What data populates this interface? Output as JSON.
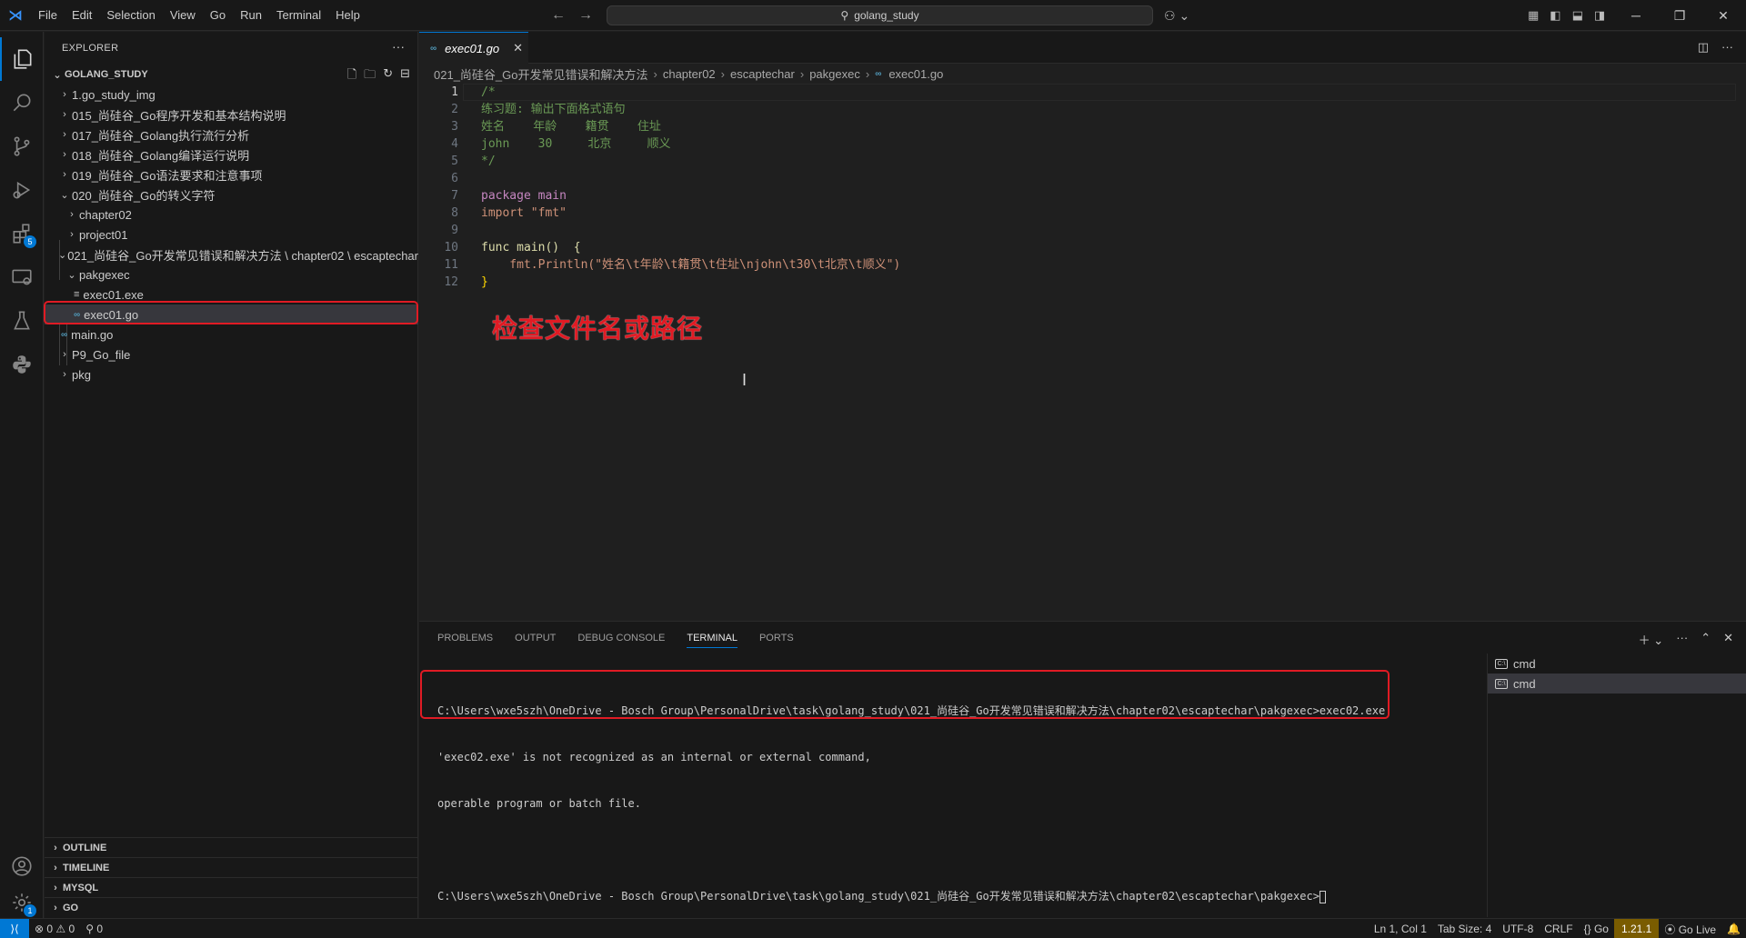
{
  "titlebar": {
    "menu": [
      "File",
      "Edit",
      "Selection",
      "View",
      "Go",
      "Run",
      "Terminal",
      "Help"
    ],
    "search_text": "golang_study"
  },
  "explorer": {
    "title": "EXPLORER",
    "project": "GOLANG_STUDY",
    "tree": [
      {
        "label": "1.go_study_img",
        "type": "folder",
        "expanded": false,
        "depth": 0
      },
      {
        "label": "015_尚硅谷_Go程序开发和基本结构说明",
        "type": "folder",
        "expanded": false,
        "depth": 0
      },
      {
        "label": "017_尚硅谷_Golang执行流行分析",
        "type": "folder",
        "expanded": false,
        "depth": 0
      },
      {
        "label": "018_尚硅谷_Golang编译运行说明",
        "type": "folder",
        "expanded": false,
        "depth": 0
      },
      {
        "label": "019_尚硅谷_Go语法要求和注意事项",
        "type": "folder",
        "expanded": false,
        "depth": 0
      },
      {
        "label": "020_尚硅谷_Go的转义字符",
        "type": "folder",
        "expanded": true,
        "depth": 0
      },
      {
        "label": "chapter02",
        "type": "folder",
        "expanded": false,
        "depth": 1
      },
      {
        "label": "project01",
        "type": "folder",
        "expanded": false,
        "depth": 1
      },
      {
        "label": "021_尚硅谷_Go开发常见错误和解决方法 \\ chapter02 \\ escaptechar",
        "type": "folder",
        "expanded": true,
        "depth": 0
      },
      {
        "label": "pakgexec",
        "type": "folder",
        "expanded": true,
        "depth": 1
      },
      {
        "label": "exec01.exe",
        "type": "exe",
        "depth": 2
      },
      {
        "label": "exec01.go",
        "type": "go",
        "depth": 2,
        "selected": true
      },
      {
        "label": "main.go",
        "type": "go",
        "depth": 0
      },
      {
        "label": "P9_Go_file",
        "type": "folder",
        "expanded": false,
        "depth": 0
      },
      {
        "label": "pkg",
        "type": "folder",
        "expanded": false,
        "depth": 0
      }
    ],
    "sections": [
      "OUTLINE",
      "TIMELINE",
      "MYSQL",
      "GO"
    ]
  },
  "editor": {
    "tab": "exec01.go",
    "breadcrumb": [
      "021_尚硅谷_Go开发常见错误和解决方法",
      "chapter02",
      "escaptechar",
      "pakgexec",
      "exec01.go"
    ],
    "lines": [
      "/*",
      "练习题: 输出下面格式语句",
      "姓名    年龄    籍贯    住址",
      "john    30     北京     顺义",
      "*/",
      "",
      "package main",
      "import \"fmt\"",
      "",
      "func main()  {",
      "    fmt.Println(\"姓名\\t年龄\\t籍贯\\t住址\\njohn\\t30\\t北京\\t顺义\")",
      "}"
    ],
    "line_numbers": [
      "1",
      "2",
      "3",
      "4",
      "5",
      "6",
      "7",
      "8",
      "9",
      "10",
      "11",
      "12"
    ],
    "annotation": "检查文件名或路径"
  },
  "panel": {
    "tabs": [
      "PROBLEMS",
      "OUTPUT",
      "DEBUG CONSOLE",
      "TERMINAL",
      "PORTS"
    ],
    "active_tab": "TERMINAL",
    "terminal_lines": [
      "C:\\Users\\wxe5szh\\OneDrive - Bosch Group\\PersonalDrive\\task\\golang_study\\021_尚硅谷_Go开发常见错误和解决方法\\chapter02\\escaptechar\\pakgexec>exec02.exe",
      "'exec02.exe' is not recognized as an internal or external command,",
      "operable program or batch file.",
      "",
      "C:\\Users\\wxe5szh\\OneDrive - Bosch Group\\PersonalDrive\\task\\golang_study\\021_尚硅谷_Go开发常见错误和解决方法\\chapter02\\escaptechar\\pakgexec>"
    ],
    "terminals": [
      "cmd",
      "cmd"
    ]
  },
  "statusbar": {
    "errors": "0",
    "warnings": "0",
    "ports": "0",
    "position": "Ln 1, Col 1",
    "tab_size": "Tab Size: 4",
    "encoding": "UTF-8",
    "eol": "CRLF",
    "language": "Go",
    "go_version": "1.21.1",
    "go_live": "Go Live"
  }
}
